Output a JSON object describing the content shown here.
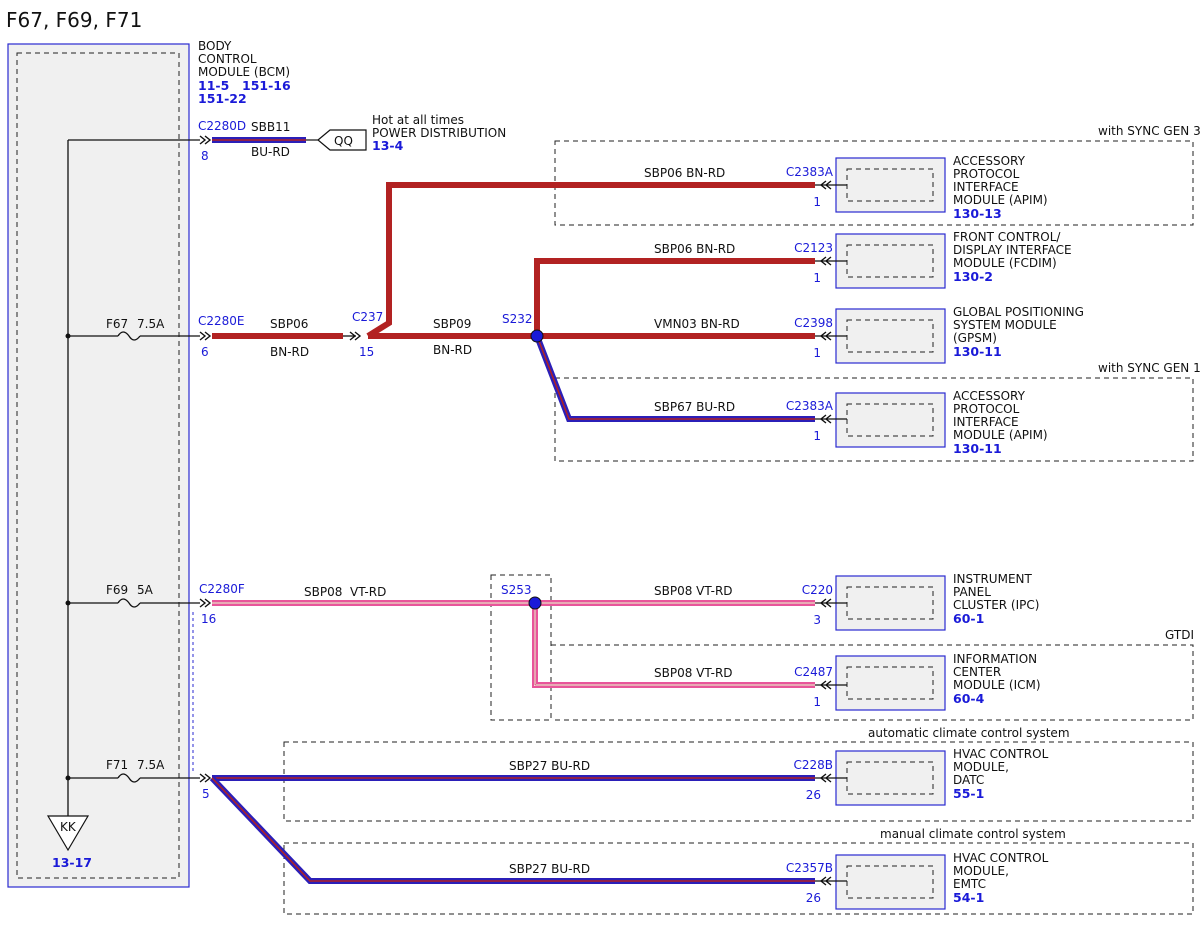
{
  "title": "F67, F69, F71",
  "colors": {
    "bn_rd": "#b22222",
    "bu_rd": "#2b1fb8",
    "vt_rd": "#e8559a",
    "link": "#1a1ad8",
    "module_fill": "#f0f0f0"
  },
  "bcm": {
    "name_lines": [
      "BODY",
      "CONTROL",
      "MODULE (BCM)"
    ],
    "refs_line1a": "11-5",
    "refs_line1b": "151-16",
    "refs_line2": "151-22"
  },
  "power": {
    "connector": "C2280D",
    "pin": "8",
    "circuit": "SBB11",
    "color": "BU-RD",
    "tag": "QQ",
    "desc1": "Hot at all times",
    "desc2": "POWER DISTRIBUTION",
    "ref": "13-4"
  },
  "fuses": [
    {
      "id": "F67",
      "rating": "7.5A"
    },
    {
      "id": "F69",
      "rating": "5A"
    },
    {
      "id": "F71",
      "rating": "7.5A"
    }
  ],
  "ground": {
    "tag": "KK",
    "ref": "13-17"
  },
  "f67_branch": {
    "bcm_connector": "C2280E",
    "bcm_pin": "6",
    "circuit1": "SBP06",
    "color1": "BN-RD",
    "inline_connector": "C237",
    "inline_pin": "15",
    "circuit2": "SBP09",
    "color2": "BN-RD",
    "splice": "S232"
  },
  "f69_branch": {
    "bcm_connector": "C2280F",
    "bcm_pin": "16",
    "circuit": "SBP08  VT-RD",
    "splice": "S253"
  },
  "f71_branch": {
    "bcm_pin": "5"
  },
  "groups": {
    "sync3": "with SYNC GEN 3",
    "sync1": "with SYNC GEN 1",
    "gtdi": "GTDI",
    "auto_climate": "automatic climate control system",
    "manual_climate": "manual climate control system"
  },
  "modules": [
    {
      "key": "apim3",
      "circuit": "SBP06  BN-RD",
      "connector": "C2383A",
      "pin": "1",
      "lines": [
        "ACCESSORY",
        "PROTOCOL",
        "INTERFACE",
        "MODULE (APIM)"
      ],
      "ref": "130-13"
    },
    {
      "key": "fcdim",
      "circuit": "SBP06  BN-RD",
      "connector": "C2123",
      "pin": "1",
      "lines": [
        "FRONT CONTROL/",
        "DISPLAY INTERFACE",
        "MODULE (FCDIM)"
      ],
      "ref": "130-2"
    },
    {
      "key": "gpsm",
      "circuit": "VMN03  BN-RD",
      "connector": "C2398",
      "pin": "1",
      "lines": [
        "GLOBAL POSITIONING",
        "SYSTEM MODULE",
        "(GPSM)"
      ],
      "ref": "130-11"
    },
    {
      "key": "apim1",
      "circuit": "SBP67  BU-RD",
      "connector": "C2383A",
      "pin": "1",
      "lines": [
        "ACCESSORY",
        "PROTOCOL",
        "INTERFACE",
        "MODULE (APIM)"
      ],
      "ref": "130-11"
    },
    {
      "key": "ipc",
      "circuit": "SBP08  VT-RD",
      "connector": "C220",
      "pin": "3",
      "lines": [
        "INSTRUMENT",
        "PANEL",
        "CLUSTER (IPC)"
      ],
      "ref": "60-1"
    },
    {
      "key": "icm",
      "circuit": "SBP08  VT-RD",
      "connector": "C2487",
      "pin": "1",
      "lines": [
        "INFORMATION",
        "CENTER",
        "MODULE (ICM)"
      ],
      "ref": "60-4"
    },
    {
      "key": "datc",
      "circuit": "SBP27  BU-RD",
      "connector": "C228B",
      "pin": "26",
      "lines": [
        "HVAC CONTROL",
        "MODULE,",
        "DATC"
      ],
      "ref": "55-1"
    },
    {
      "key": "emtc",
      "circuit": "SBP27  BU-RD",
      "connector": "C2357B",
      "pin": "26",
      "lines": [
        "HVAC CONTROL",
        "MODULE,",
        "EMTC"
      ],
      "ref": "54-1"
    }
  ]
}
